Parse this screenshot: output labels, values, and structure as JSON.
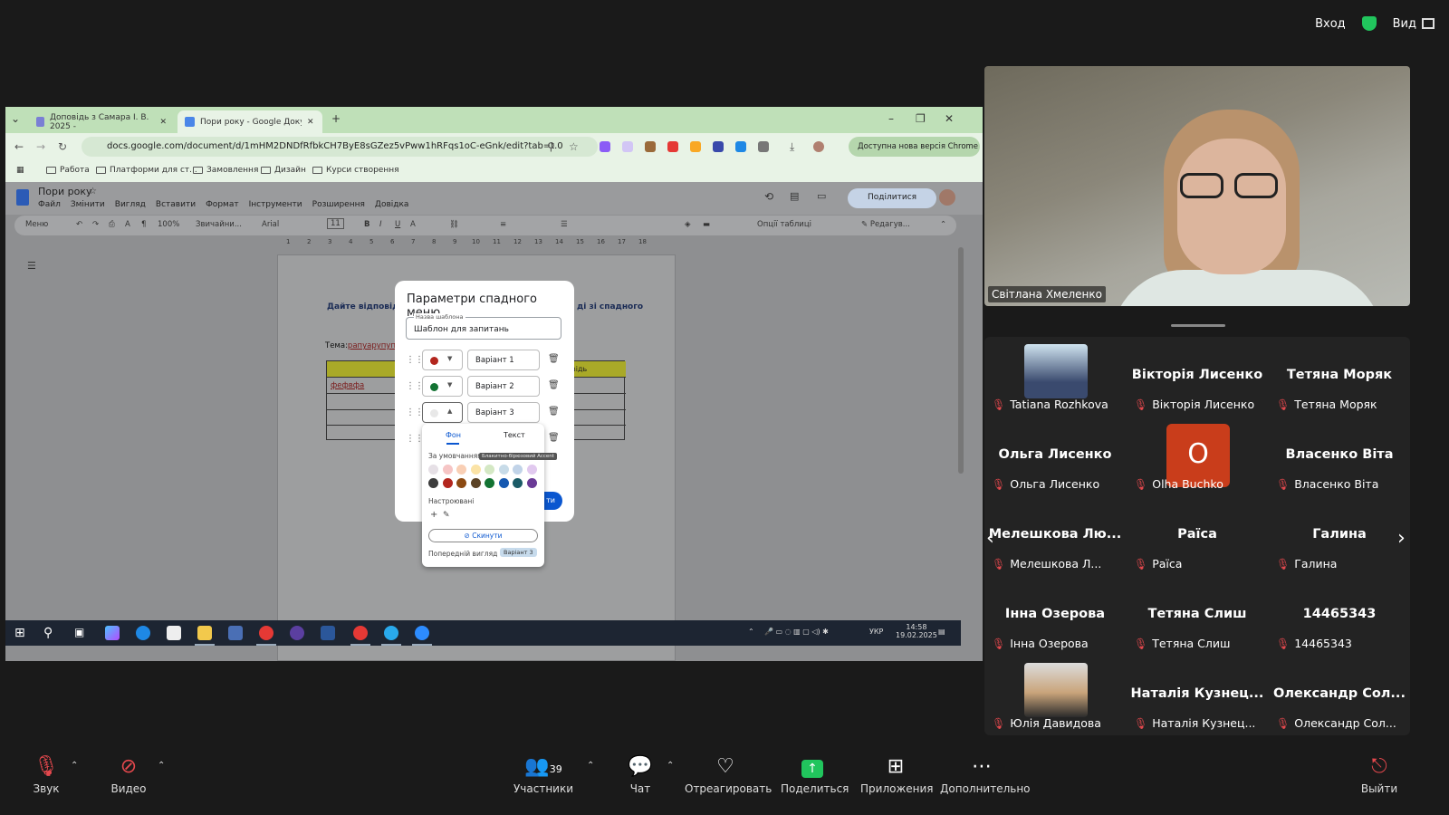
{
  "top": {
    "signin": "Вход",
    "view": "Вид"
  },
  "browser": {
    "tabs": [
      {
        "label": "Доповідь з Самара І. В. 2025 -"
      },
      {
        "label": "Пори року - Google Документи"
      }
    ],
    "url": "docs.google.com/document/d/1mHM2DNDfRfbkCH7ByE8sGZez5vPww1hRFqs1oC-eGnk/edit?tab=t.0",
    "chrome_update": "Доступна нова версія Chrome",
    "bookmarks": [
      "Работа",
      "Платформи для ст...",
      "Замовлення",
      "Дизайн",
      "Курси створення"
    ]
  },
  "docs": {
    "title": "Пори року",
    "menu": [
      "Файл",
      "Змінити",
      "Вигляд",
      "Вставити",
      "Формат",
      "Інструменти",
      "Розширення",
      "Довідка"
    ],
    "share": "Поділитися",
    "toolbar": {
      "menu": "Меню",
      "zoom": "100%",
      "style": "Звичайни...",
      "font": "Arial",
      "size": "11",
      "table_opts": "Опції таблиці",
      "edit_mode": "Редагув..."
    },
    "ruler": [
      "1",
      "2",
      "3",
      "4",
      "5",
      "6",
      "7",
      "8",
      "9",
      "10",
      "11",
      "12",
      "13",
      "14",
      "15",
      "16",
      "17",
      "18"
    ],
    "heading_left": "Дайте відповіді на",
    "heading_right": "ді зі спадного",
    "tema": "Тема:",
    "tema_value": "рапуарупуп",
    "cell": "фефвфа",
    "col_header": "відь"
  },
  "dialog": {
    "title": "Параметри спадного меню",
    "template_label": "Назва шаблона",
    "template_value": "Шаблон для запитань",
    "options": [
      {
        "label": "Варіант 1",
        "color": "#b3261e"
      },
      {
        "label": "Варіант 2",
        "color": "#137333"
      },
      {
        "label": "Варіант 3",
        "color": "#e8e8e8"
      }
    ],
    "ok_label": "ти"
  },
  "palette": {
    "tab_bg": "Фон",
    "tab_text": "Текст",
    "default_label": "За умовчанням",
    "tooltip": "Блакитно-бірюзовий Accent",
    "light_colors": [
      "#e6e0e6",
      "#f6c5c5",
      "#f9cfb5",
      "#fbe3a6",
      "#d4e8c4",
      "#c7dbe8",
      "#c1d3e8",
      "#e1c9ef"
    ],
    "dark_colors": [
      "#3c3c3c",
      "#b3261e",
      "#8c4a12",
      "#5c4326",
      "#137333",
      "#1558b0",
      "#1a5b66",
      "#6a3a96"
    ],
    "custom_label": "Настроювані",
    "reset": "Скинути",
    "preview_label": "Попередній вигляд",
    "preview_value": "Варіант 3"
  },
  "taskbar": {
    "lang": "УКР",
    "time": "14:58",
    "date": "19.02.2025"
  },
  "presenter": {
    "name": "Світлана Хмеленко"
  },
  "participants": [
    {
      "display": "",
      "label": "Tatiana Rozhkova",
      "avatar": "photo"
    },
    {
      "display": "Вікторія Лисенко",
      "label": "Вікторія Лисенко",
      "avatar": ""
    },
    {
      "display": "Тетяна Моряк",
      "label": "Тетяна Моряк",
      "avatar": ""
    },
    {
      "display": "Ольга Лисенко",
      "label": "Ольга Лисенко",
      "avatar": ""
    },
    {
      "display": "O",
      "label": "Olha Buchko",
      "avatar": "letter"
    },
    {
      "display": "Власенко Віта",
      "label": "Власенко Віта",
      "avatar": ""
    },
    {
      "display": "Мелешкова  Лю...",
      "label": "Мелешкова Л...",
      "avatar": ""
    },
    {
      "display": "Раїса",
      "label": "Раїса",
      "avatar": ""
    },
    {
      "display": "Галина",
      "label": "Галина",
      "avatar": ""
    },
    {
      "display": "Інна Озерова",
      "label": "Інна Озерова",
      "avatar": ""
    },
    {
      "display": "Тетяна Слиш",
      "label": "Тетяна Слиш",
      "avatar": ""
    },
    {
      "display": "14465343",
      "label": "14465343",
      "avatar": ""
    },
    {
      "display": "",
      "label": "Юлія Давидова",
      "avatar": "photo2"
    },
    {
      "display": "Наталія  Кузнец...",
      "label": "Наталія Кузнец...",
      "avatar": ""
    },
    {
      "display": "Олександр  Сол...",
      "label": "Олександр Сол...",
      "avatar": ""
    }
  ],
  "bottom": {
    "audio": "Звук",
    "video": "Видео",
    "participants": "Участники",
    "participants_count": "39",
    "chat": "Чат",
    "react": "Отреагировать",
    "share": "Поделиться",
    "apps": "Приложения",
    "more": "Дополнительно",
    "leave": "Выйти"
  }
}
